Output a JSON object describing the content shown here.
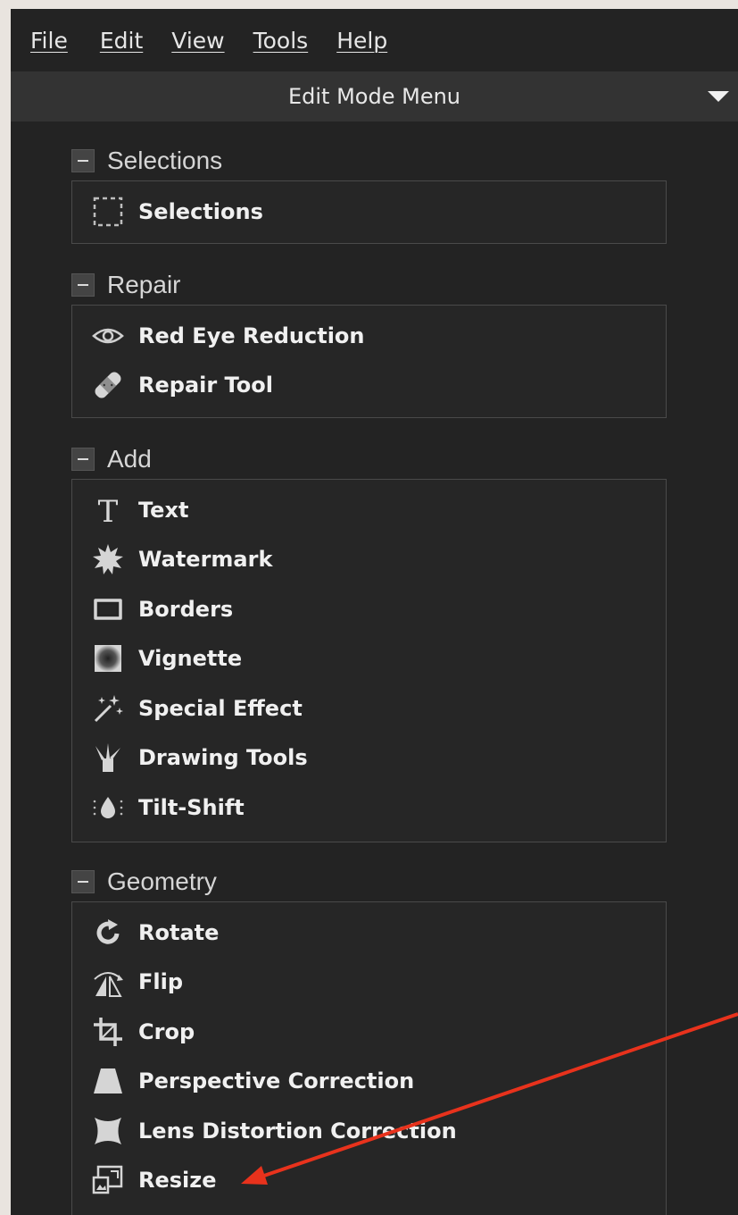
{
  "menubar": {
    "items": [
      {
        "label": "File"
      },
      {
        "label": "Edit"
      },
      {
        "label": "View"
      },
      {
        "label": "Tools"
      },
      {
        "label": "Help"
      }
    ]
  },
  "panel": {
    "title": "Edit Mode Menu"
  },
  "sections": {
    "selections": {
      "title": "Selections",
      "items": [
        {
          "label": "Selections",
          "icon": "dashed-selection-icon"
        }
      ]
    },
    "repair": {
      "title": "Repair",
      "items": [
        {
          "label": "Red Eye Reduction",
          "icon": "eye-icon"
        },
        {
          "label": "Repair Tool",
          "icon": "bandage-icon"
        }
      ]
    },
    "add": {
      "title": "Add",
      "items": [
        {
          "label": "Text",
          "icon": "text-icon"
        },
        {
          "label": "Watermark",
          "icon": "starburst-icon"
        },
        {
          "label": "Borders",
          "icon": "border-frame-icon"
        },
        {
          "label": "Vignette",
          "icon": "vignette-icon"
        },
        {
          "label": "Special Effect",
          "icon": "magic-wand-icon"
        },
        {
          "label": "Drawing Tools",
          "icon": "brushes-icon"
        },
        {
          "label": "Tilt-Shift",
          "icon": "tilt-shift-drop-icon"
        }
      ]
    },
    "geometry": {
      "title": "Geometry",
      "items": [
        {
          "label": "Rotate",
          "icon": "rotate-icon"
        },
        {
          "label": "Flip",
          "icon": "flip-icon"
        },
        {
          "label": "Crop",
          "icon": "crop-icon"
        },
        {
          "label": "Perspective Correction",
          "icon": "trapezoid-icon"
        },
        {
          "label": "Lens Distortion Correction",
          "icon": "lens-distortion-icon"
        },
        {
          "label": "Resize",
          "icon": "resize-icon"
        }
      ]
    }
  },
  "annotation": {
    "color": "#e8321c",
    "target": "Resize"
  },
  "colors": {
    "panel_bg": "#232323",
    "header_bg": "#333333",
    "text": "#f0f0f0"
  }
}
